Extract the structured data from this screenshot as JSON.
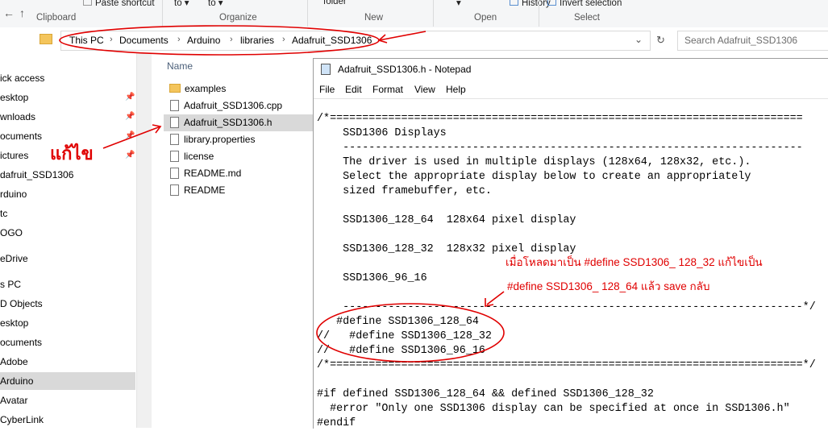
{
  "ribbon": {
    "paste_shortcut": "Paste shortcut",
    "move_to_1": "to",
    "move_to_2": "to",
    "folder": "folder",
    "history": "History",
    "invert_selection": "Invert selection",
    "groups": {
      "clipboard": "Clipboard",
      "organize": "Organize",
      "new": "New",
      "open": "Open",
      "select": "Select"
    }
  },
  "address": {
    "crumbs": [
      "This PC",
      "Documents",
      "Arduino",
      "libraries",
      "Adafruit_SSD1306"
    ],
    "search_placeholder": "Search Adafruit_SSD1306"
  },
  "nav": {
    "items": [
      "ick access",
      "esktop",
      "wnloads",
      "ocuments",
      "ictures",
      "dafruit_SSD1306",
      "rduino",
      "tc",
      "OGO",
      "eDrive",
      "s PC",
      "D Objects",
      "esktop",
      "ocuments",
      "Adobe",
      "Arduino",
      "Avatar",
      "CyberLink"
    ],
    "selected_index": 15
  },
  "files": {
    "column_name": "Name",
    "items": [
      {
        "name": "examples",
        "type": "folder"
      },
      {
        "name": "Adafruit_SSD1306.cpp",
        "type": "file"
      },
      {
        "name": "Adafruit_SSD1306.h",
        "type": "file"
      },
      {
        "name": "library.properties",
        "type": "file"
      },
      {
        "name": "license",
        "type": "file"
      },
      {
        "name": "README.md",
        "type": "file"
      },
      {
        "name": "README",
        "type": "file"
      }
    ],
    "selected_index": 2
  },
  "notepad": {
    "title": "Adafruit_SSD1306.h - Notepad",
    "menu": [
      "File",
      "Edit",
      "Format",
      "View",
      "Help"
    ],
    "lines": [
      "/*=========================================================================",
      "    SSD1306 Displays",
      "    -----------------------------------------------------------------------",
      "    The driver is used in multiple displays (128x64, 128x32, etc.).",
      "    Select the appropriate display below to create an appropriately",
      "    sized framebuffer, etc.",
      "",
      "    SSD1306_128_64  128x64 pixel display",
      "",
      "    SSD1306_128_32  128x32 pixel display",
      "",
      "    SSD1306_96_16",
      "",
      "    -----------------------------------------------------------------------*/",
      "   #define SSD1306_128_64",
      "//   #define SSD1306_128_32",
      "//   #define SSD1306_96_16",
      "/*=========================================================================*/",
      "",
      "#if defined SSD1306_128_64 && defined SSD1306_128_32",
      "  #error \"Only one SSD1306 display can be specified at once in SSD1306.h\"",
      "#endif"
    ]
  },
  "annotations": {
    "edit_label": "แก้ไข",
    "note_line1": "เมื่อโหลดมาเป็น #define SSD1306_ 128_32 แก้ไขเป็น",
    "note_line2": "#define SSD1306_ 128_64 แล้ว save กลับ",
    "color": "#e00000"
  }
}
